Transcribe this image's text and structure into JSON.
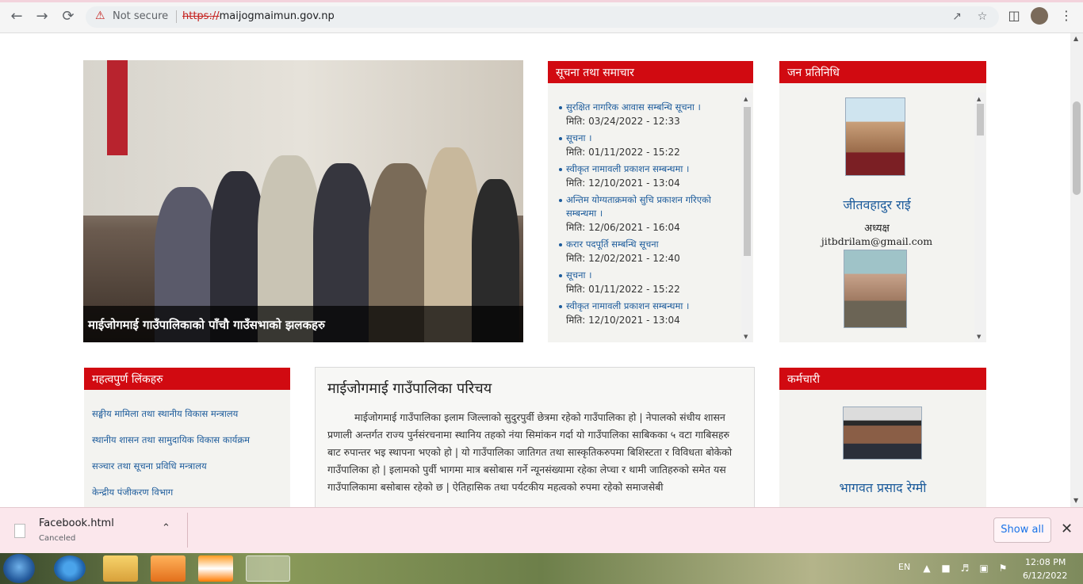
{
  "browser": {
    "security_label": "Not secure",
    "url_scheme": "https://",
    "url_host": "maijogmaimun.gov.np",
    "icons": [
      "back-icon",
      "forward-icon",
      "reload-icon",
      "warning-icon",
      "share-icon",
      "star-icon",
      "sidepanel-icon",
      "avatar",
      "menu-icon"
    ]
  },
  "slider": {
    "caption": "माईजोगमाई गाउँपालिकाको पाँचौ गाउँसभाको झलकहरु"
  },
  "news": {
    "heading": "सूचना तथा समाचार",
    "items": [
      {
        "title": "सुरक्षित नागरिक आवास सम्बन्धि सूचना ।",
        "date": "मिति: 03/24/2022 - 12:33"
      },
      {
        "title": "सूचना ।",
        "date": "मिति: 01/11/2022 - 15:22"
      },
      {
        "title": "स्वीकृत नामावली प्रकाशन सम्बन्धमा ।",
        "date": "मिति: 12/10/2021 - 13:04"
      },
      {
        "title": "अन्तिम योग्यताक्रमको सुचि प्रकाशन गरिएको सम्बन्धमा ।",
        "date": "मिति: 12/06/2021 - 16:04"
      },
      {
        "title": "करार पदपूर्ति सम्बन्धि सूचना",
        "date": "मिति: 12/02/2021 - 12:40"
      },
      {
        "title": "सूचना ।",
        "date": "मिति: 01/11/2022 - 15:22"
      },
      {
        "title": "स्वीकृत नामावली प्रकाशन सम्बन्धमा ।",
        "date": "मिति: 12/10/2021 - 13:04"
      }
    ]
  },
  "representatives": {
    "heading": "जन प्रतिनिधि",
    "people": [
      {
        "name": "जीतवहादुर राई",
        "role": "अध्यक्ष",
        "email": "jitbdrilam@gmail.com"
      }
    ]
  },
  "important_links": {
    "heading": "महत्वपुर्ण लिंकहरु",
    "items": [
      "सङ्घीय मामिला तथा स्थानीय विकास मन्त्रालय",
      "स्थानीय शासन तथा सामुदायिक विकास कार्यक्रम",
      "सञ्चार तथा सूचना प्रविधि मन्त्रालय",
      "केन्द्रीय पंजीकरण विभाग"
    ]
  },
  "intro": {
    "heading": "माईजोगमाई गाउँपालिका परिचय",
    "body": "माईजोगमाई गाउँपालिका इलाम जिल्लाको सुदुरपुर्वी छेत्रमा रहेको गाउँपालिका हो | नेपालको संधीय शासन प्रणाली अन्तर्गत राज्य पुर्नसंरचनामा स्थानिय तहको नंया सिमांकन गर्दा यो गाउँपालिका साबिकका ५ वटा गाबिसहरु बाट रुपान्तर भइ स्थापना भएको हो | यो गाउँपालिका जातिगत तथा सास्कृतिकरुपमा बिशिस्टता र विविधता बोकेको गाउँपालिका हो | इलामको पुर्वी भागमा मात्र बसोबास गर्ने न्यूनसंख्यामा रहेका लेप्चा र थामी जातिहरुको समेत यस गाउँपालिकामा बसोबास रहेको छ | ऐतिहासिक तथा पर्यटकीय महत्वको रुपमा रहेको समाजसेबी"
  },
  "staff": {
    "heading": "कर्मचारी",
    "people": [
      {
        "name": "भागवत प्रसाद रेग्मी"
      }
    ]
  },
  "download": {
    "filename": "Facebook.html",
    "status": "Canceled",
    "show_all": "Show all"
  },
  "taskbar": {
    "lang": "EN",
    "time": "12:08 PM",
    "date": "6/12/2022"
  }
}
